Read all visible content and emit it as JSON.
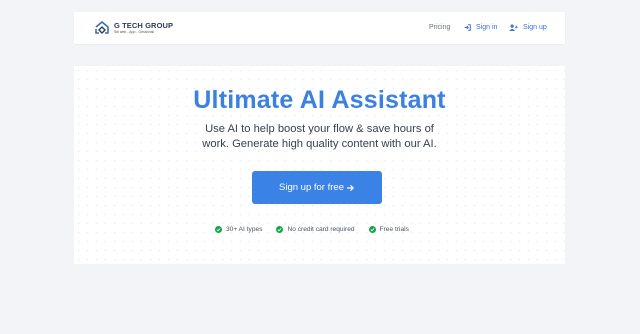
{
  "brand": {
    "name": "G TECH GROUP",
    "tagline": "Siti web - App - Gestionali"
  },
  "nav": {
    "pricing": "Pricing",
    "sign_in": "Sign in",
    "sign_up": "Sign up"
  },
  "hero": {
    "title": "Ultimate AI Assistant",
    "subtitle_line1": "Use AI to help boost your flow & save hours of",
    "subtitle_line2": "work. Generate high quality content with our AI.",
    "cta_label": "Sign up for free"
  },
  "features": [
    {
      "label": "30+ AI types"
    },
    {
      "label": "No credit card required"
    },
    {
      "label": "Free trials"
    }
  ],
  "colors": {
    "accent": "#3b82e6",
    "title": "#3b82e0",
    "check": "#16a34a",
    "background": "#f3f4f8"
  }
}
